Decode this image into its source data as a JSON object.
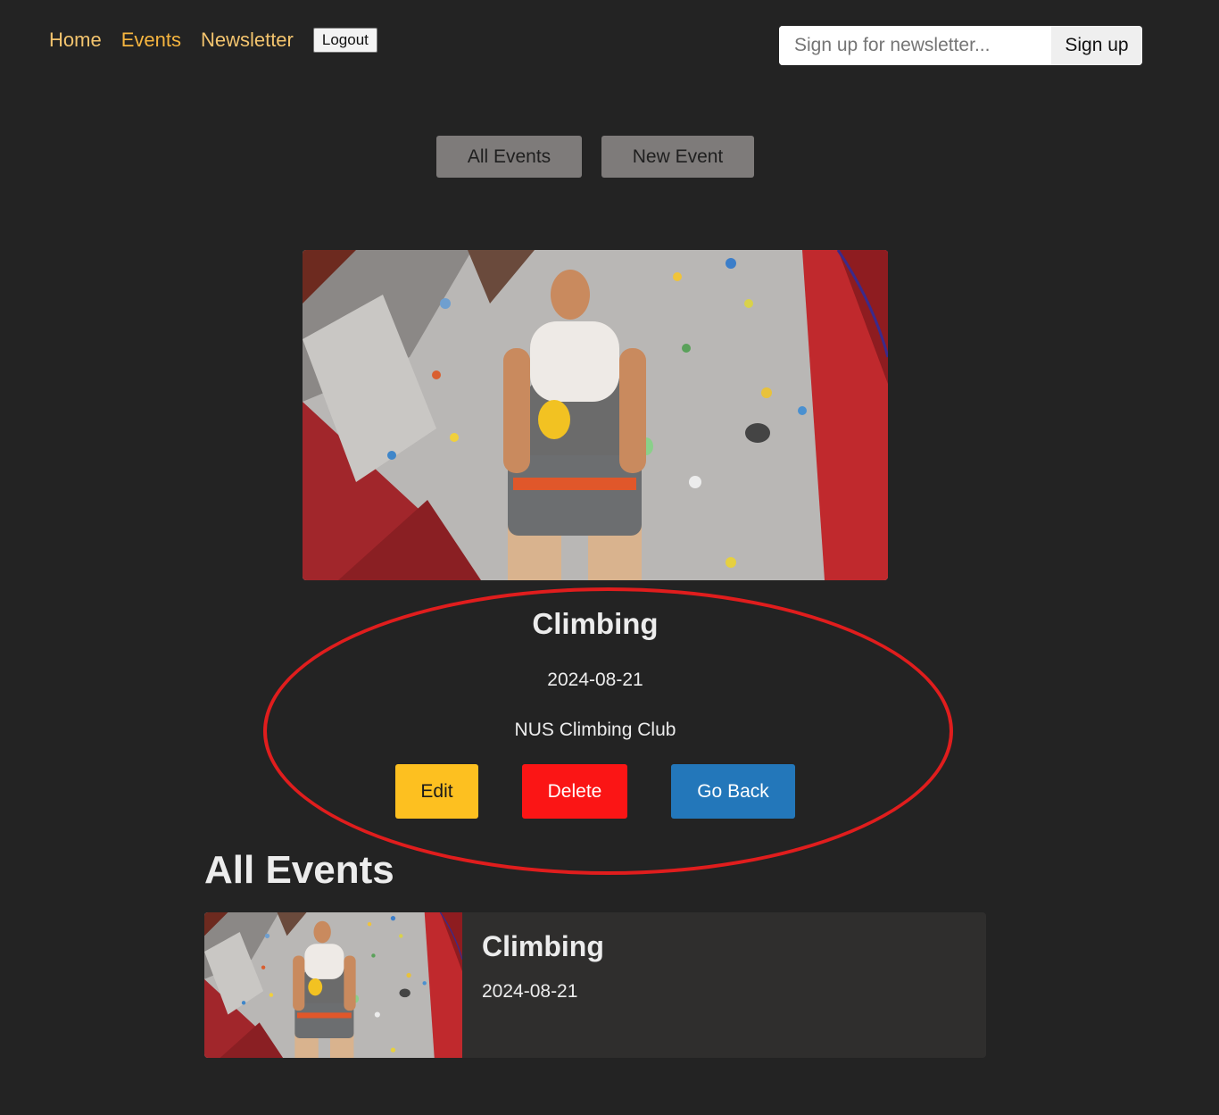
{
  "nav": {
    "home": "Home",
    "events": "Events",
    "newsletter": "Newsletter",
    "logout": "Logout"
  },
  "newsletter_form": {
    "placeholder": "Sign up for newsletter...",
    "button": "Sign up"
  },
  "subnav": {
    "all_events": "All Events",
    "new_event": "New Event"
  },
  "event": {
    "title": "Climbing",
    "date": "2024-08-21",
    "organizer": "NUS Climbing Club",
    "edit": "Edit",
    "delete": "Delete",
    "go_back": "Go Back"
  },
  "all_events": {
    "heading": "All Events",
    "items": [
      {
        "title": "Climbing",
        "date": "2024-08-21"
      }
    ]
  },
  "colors": {
    "background": "#232323",
    "nav_link": "#f3c46e",
    "edit": "#fdc020",
    "delete": "#fb1515",
    "go_back": "#2377ba",
    "annotation": "#e01d1d"
  }
}
